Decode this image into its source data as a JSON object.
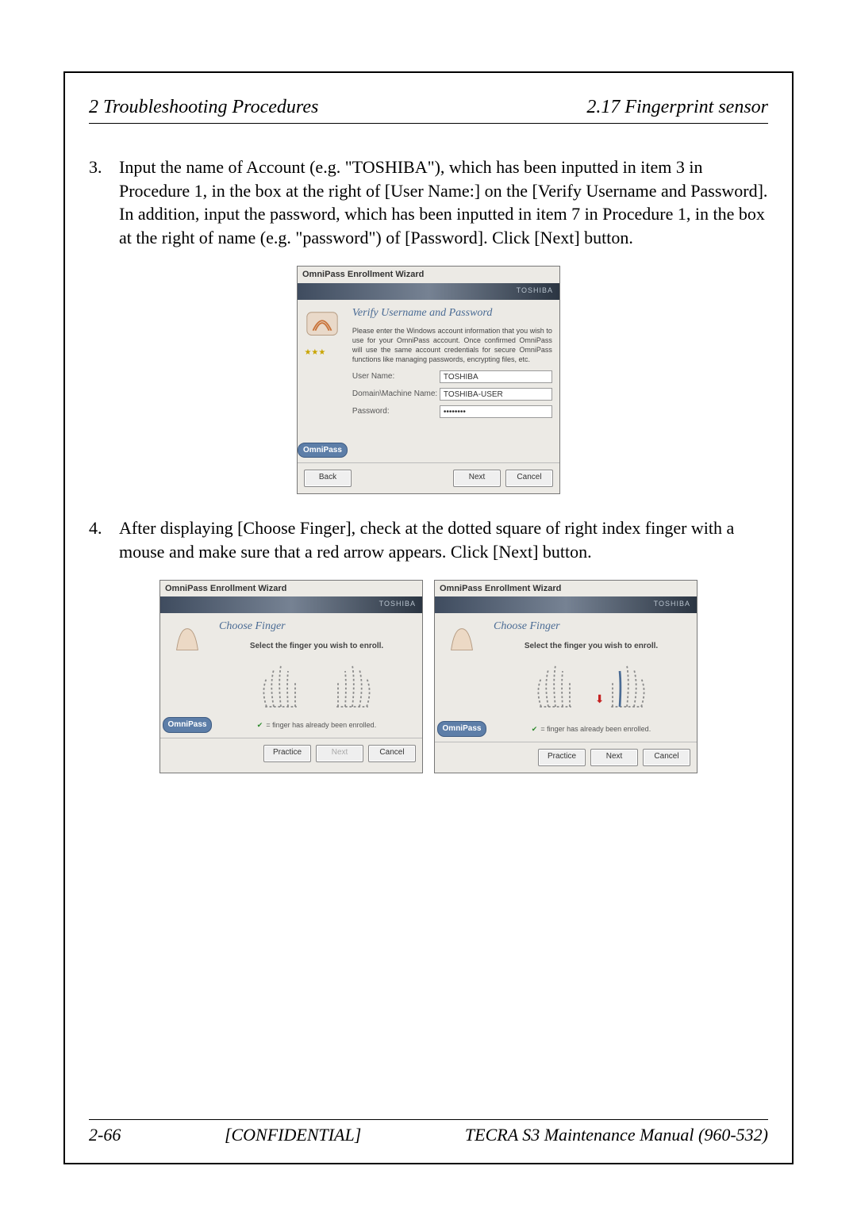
{
  "header": {
    "left": "2  Troubleshooting Procedures",
    "right": "2.17 Fingerprint sensor"
  },
  "steps": {
    "s3": {
      "num": "3.",
      "text": "Input the name of Account (e.g. \"TOSHIBA\"), which has been inputted in item 3 in Procedure 1, in the box at the right of [User Name:] on the [Verify Username and Password]. In addition, input the password, which has been inputted in item 7 in Procedure 1, in the box at the right of name (e.g. \"password\") of [Password]. Click [Next] button."
    },
    "s4": {
      "num": "4.",
      "text": "After displaying [Choose Finger], check at the dotted square of right index finger with a mouse and make sure that a red arrow appears. Click [Next] button."
    }
  },
  "wizard1": {
    "title": "OmniPass Enrollment Wizard",
    "brand": "TOSHIBA",
    "heading": "Verify Username and Password",
    "desc": "Please enter the Windows account information that you wish to use for your OmniPass account. Once confirmed OmniPass will use the same account credentials for secure OmniPass functions like managing passwords, encrypting files, etc.",
    "fields": {
      "uname_label": "User Name:",
      "uname_value": "TOSHIBA",
      "domain_label": "Domain\\Machine Name:",
      "domain_value": "TOSHIBA-USER",
      "pass_label": "Password:",
      "pass_value": "********"
    },
    "badge": "OmniPass",
    "buttons": {
      "back": "Back",
      "next": "Next",
      "cancel": "Cancel"
    }
  },
  "wizard2": {
    "title": "OmniPass Enrollment Wizard",
    "brand": "TOSHIBA",
    "heading": "Choose Finger",
    "select_note": "Select the finger you wish to enroll.",
    "enrolled_note": "= finger has already been enrolled.",
    "badge": "OmniPass",
    "buttons": {
      "practice": "Practice",
      "next": "Next",
      "cancel": "Cancel"
    }
  },
  "footer": {
    "page": "2-66",
    "center": "[CONFIDENTIAL]",
    "right": "TECRA S3 Maintenance Manual (960-532)"
  }
}
